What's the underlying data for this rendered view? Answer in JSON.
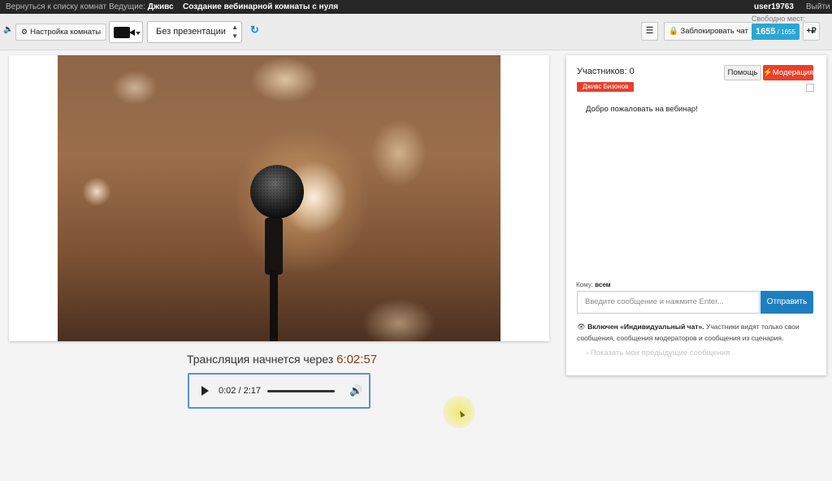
{
  "topbar": {
    "back_link": "Вернуться к списку комнат",
    "host_label": "Ведущие: ",
    "host_name": "Дживс",
    "room_title": "Создание вебинарной комнаты с нуля",
    "user": "user19763",
    "logout": "Выйти"
  },
  "toolbar": {
    "settings_icon": "gear-icon",
    "settings_label": "Настройка комнаты",
    "presentation_selected": "Без презентации",
    "menu_icon": "hamburger-icon",
    "lock_icon": "lock-icon",
    "lock_label": "Заблокировать чат",
    "free_seats_label": "Свободно мест:",
    "seats_free": "1655",
    "seats_sep": " / ",
    "seats_total": "1655",
    "add_seats_label": "+₽"
  },
  "player": {
    "countdown_label": "Трансляция начнется через ",
    "countdown_time": "6:02:57",
    "audio_time": "0:02 / 2:17",
    "audio_progress": 0.015
  },
  "chat": {
    "participants": "Участников: 0",
    "help_label": "Помощь",
    "moderation_label": "Модерация",
    "host_badge": "Дживс Бизонов",
    "welcome": "Добро пожаловать на вебинар!",
    "to_label": "Кому: ",
    "to_value": "всем",
    "input_placeholder": "Введите сообщение и нажмите Enter...",
    "send_label": "Отправить",
    "info_bold": "Включен «Индивидуальный чат».",
    "info_text": " Участники видят только свои сообщения, сообщения модераторов и сообщения из сценария.",
    "prev_label": "Показать мои предыдущие сообщения"
  },
  "colors": {
    "accent": "#1e7fc0",
    "danger": "#e8402a",
    "seats": "#2aa6d6"
  }
}
